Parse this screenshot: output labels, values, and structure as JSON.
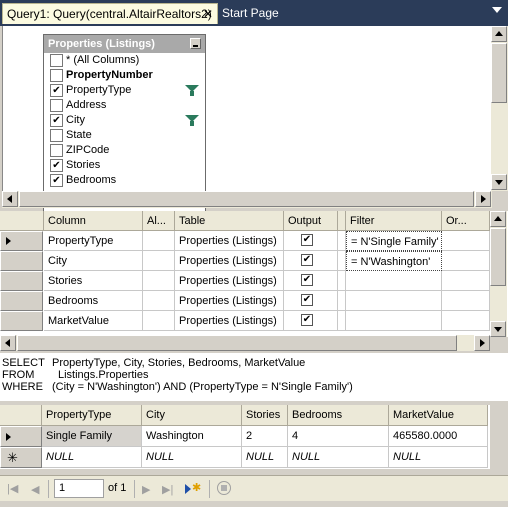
{
  "tabs": {
    "active_label": "Query1: Query(central.AltairRealtors2)",
    "close_glyph": "✕",
    "second_label": "Start Page"
  },
  "diagram": {
    "table_title": "Properties (Listings)",
    "columns": [
      {
        "label": "* (All Columns)",
        "checked": false,
        "bold": false,
        "filter": false
      },
      {
        "label": "PropertyNumber",
        "checked": false,
        "bold": true,
        "filter": false
      },
      {
        "label": "PropertyType",
        "checked": true,
        "bold": false,
        "filter": true
      },
      {
        "label": "Address",
        "checked": false,
        "bold": false,
        "filter": false
      },
      {
        "label": "City",
        "checked": true,
        "bold": false,
        "filter": true
      },
      {
        "label": "State",
        "checked": false,
        "bold": false,
        "filter": false
      },
      {
        "label": "ZIPCode",
        "checked": false,
        "bold": false,
        "filter": false
      },
      {
        "label": "Stories",
        "checked": true,
        "bold": false,
        "filter": false
      },
      {
        "label": "Bedrooms",
        "checked": true,
        "bold": false,
        "filter": false
      }
    ]
  },
  "criteria": {
    "headers": {
      "column": "Column",
      "alias": "Al...",
      "table": "Table",
      "output": "Output",
      "filter": "Filter",
      "or": "Or..."
    },
    "rows": [
      {
        "column": "PropertyType",
        "table": "Properties (Listings)",
        "output": true,
        "filter": "= N'Single Family'"
      },
      {
        "column": "City",
        "table": "Properties (Listings)",
        "output": true,
        "filter": "= N'Washington'"
      },
      {
        "column": "Stories",
        "table": "Properties (Listings)",
        "output": true,
        "filter": ""
      },
      {
        "column": "Bedrooms",
        "table": "Properties (Listings)",
        "output": true,
        "filter": ""
      },
      {
        "column": "MarketValue",
        "table": "Properties (Listings)",
        "output": true,
        "filter": ""
      }
    ]
  },
  "sql": {
    "select_kw": "SELECT",
    "select_body": "PropertyType, City, Stories, Bedrooms, MarketValue",
    "from_kw": "FROM",
    "from_body": "Listings.Properties",
    "where_kw": "WHERE",
    "where_body": "(City = N'Washington') AND (PropertyType = N'Single Family')"
  },
  "results": {
    "headers": [
      "PropertyType",
      "City",
      "Stories",
      "Bedrooms",
      "MarketValue"
    ],
    "row": [
      "Single Family",
      "Washington",
      "2",
      "4",
      "465580.0000"
    ],
    "new_row": [
      "NULL",
      "NULL",
      "NULL",
      "NULL",
      "NULL"
    ]
  },
  "navigator": {
    "current": "1",
    "of_text": "of 1"
  }
}
